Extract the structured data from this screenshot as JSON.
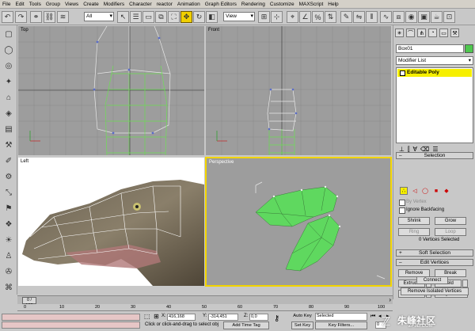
{
  "menu": [
    "File",
    "Edit",
    "Tools",
    "Group",
    "Views",
    "Create",
    "Modifiers",
    "Character",
    "reactor",
    "Animation",
    "Graph Editors",
    "Rendering",
    "Customize",
    "MAXScript",
    "Help"
  ],
  "toolbar": {
    "selection_filter": "All",
    "ref_coord": "View"
  },
  "viewports": {
    "top": "Top",
    "front": "Front",
    "left": "Left",
    "perspective": "Perspective"
  },
  "panel": {
    "object_name": "Box01",
    "modifier_list": "Modifier List",
    "stack_item": "Editable Poly",
    "selection_rollout": "Selection",
    "by_vertex": "By Vertex",
    "ignore_backfacing": "Ignore Backfacing",
    "shrink": "Shrink",
    "grow": "Grow",
    "ring": "Ring",
    "loop": "Loop",
    "vertices_selected": "0 Vertices Selected",
    "soft_selection": "Soft Selection",
    "edit_vertices": "Edit Vertices",
    "remove": "Remove",
    "break": "Break",
    "extrude": "Extrude",
    "weld": "Weld",
    "chamfer": "Chamfer",
    "target_weld": "Target Weld",
    "connect": "Connect",
    "remove_isolated": "Remove Isolated Vertices"
  },
  "timeline": {
    "frame_display": "0 / 100",
    "ticks": [
      "0",
      "10",
      "20",
      "30",
      "40",
      "50",
      "60",
      "70",
      "80",
      "90",
      "100"
    ]
  },
  "status": {
    "x_label": "X:",
    "x_value": "416,168",
    "y_label": "Y:",
    "y_value": "-314,451",
    "z_label": "Z:",
    "z_value": "0,0",
    "prompt": "Click or click-and-drag to select obj",
    "add_time_tag": "Add Time Tag",
    "auto_key": "Auto Key",
    "set_key": "Set Key",
    "key_mode": "Selected",
    "key_filters": "Key Filters...",
    "frame_field": "0"
  },
  "watermark": {
    "title": "朱峰社区",
    "url": "ZF3D.COM"
  },
  "colors": {
    "active_viewport": "#f2d400",
    "mesh_green": "#5fd85f",
    "selected_stack": "#f6ef00"
  }
}
